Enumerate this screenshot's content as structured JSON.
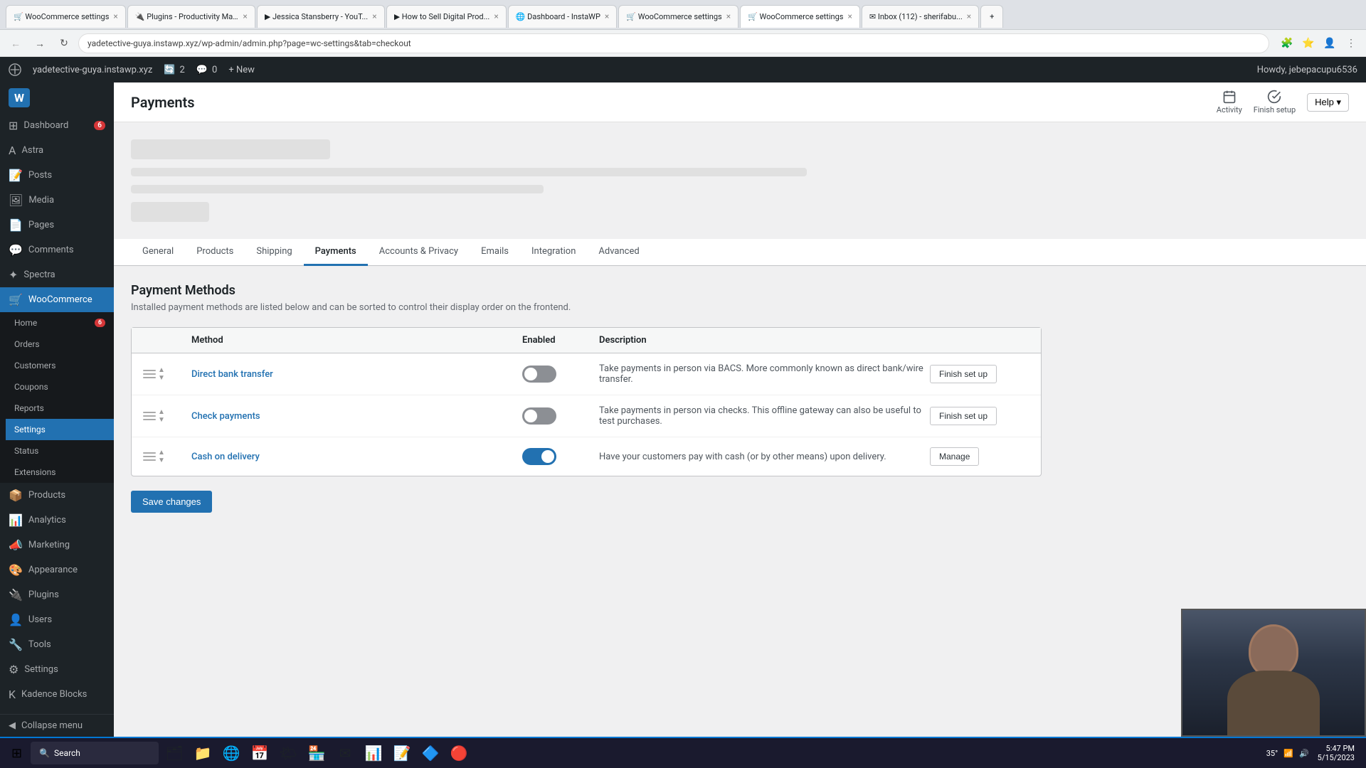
{
  "browser": {
    "tabs": [
      {
        "label": "WooCommerce settings",
        "active": false,
        "icon": "🛒"
      },
      {
        "label": "Plugins - Productivity Ma...",
        "active": false,
        "icon": "🔌"
      },
      {
        "label": "Jessica Stansberry - YouT...",
        "active": false,
        "icon": "▶"
      },
      {
        "label": "How to Sell Digital Prod...",
        "active": false,
        "icon": "▶"
      },
      {
        "label": "Dashboard - InstaWP",
        "active": false,
        "icon": "🌐"
      },
      {
        "label": "WooCommerce settings",
        "active": false,
        "icon": "🛒"
      },
      {
        "label": "WooCommerce settings",
        "active": true,
        "icon": "🛒"
      },
      {
        "label": "Inbox (112) - sherifabu...",
        "active": false,
        "icon": "✉"
      }
    ],
    "address": "yadetective-guya.instawp.xyz/wp-admin/admin.php?page=wc-settings&tab=checkout"
  },
  "admin_bar": {
    "site": "yadetective-guya.instawp.xyz",
    "updates_count": "2",
    "comments_count": "0",
    "new_label": "+ New",
    "howdy": "Howdy, jebepacupu6536"
  },
  "sidebar": {
    "logo_text": "W",
    "items": [
      {
        "label": "Dashboard",
        "icon": "⊞",
        "badge": "6"
      },
      {
        "label": "Astra",
        "icon": "A"
      },
      {
        "label": "Posts",
        "icon": "📝"
      },
      {
        "label": "Media",
        "icon": "🖼"
      },
      {
        "label": "Pages",
        "icon": "📄"
      },
      {
        "label": "Comments",
        "icon": "💬"
      },
      {
        "label": "Spectra",
        "icon": "✦"
      },
      {
        "label": "WooCommerce",
        "icon": "🛒",
        "active": true
      },
      {
        "label": "Home",
        "icon": "⌂",
        "badge": "6"
      },
      {
        "label": "Orders",
        "icon": ""
      },
      {
        "label": "Customers",
        "icon": ""
      },
      {
        "label": "Coupons",
        "icon": ""
      },
      {
        "label": "Reports",
        "icon": ""
      },
      {
        "label": "Settings",
        "icon": "",
        "active": true
      },
      {
        "label": "Status",
        "icon": ""
      },
      {
        "label": "Extensions",
        "icon": ""
      },
      {
        "label": "Products",
        "icon": "📦"
      },
      {
        "label": "Analytics",
        "icon": "📊"
      },
      {
        "label": "Marketing",
        "icon": "📣"
      },
      {
        "label": "Appearance",
        "icon": "🎨"
      },
      {
        "label": "Plugins",
        "icon": "🔌"
      },
      {
        "label": "Users",
        "icon": "👤"
      },
      {
        "label": "Tools",
        "icon": "🔧"
      },
      {
        "label": "Settings",
        "icon": "⚙"
      },
      {
        "label": "Kadence Blocks",
        "icon": "K"
      },
      {
        "label": "Collapse menu",
        "icon": "◀"
      }
    ],
    "search_label": "Search"
  },
  "header": {
    "title": "Payments",
    "activity_label": "Activity",
    "finish_setup_label": "Finish setup",
    "help_label": "Help ▾"
  },
  "tabs": [
    {
      "label": "General"
    },
    {
      "label": "Products"
    },
    {
      "label": "Shipping"
    },
    {
      "label": "Payments",
      "active": true
    },
    {
      "label": "Accounts & Privacy"
    },
    {
      "label": "Emails"
    },
    {
      "label": "Integration"
    },
    {
      "label": "Advanced"
    }
  ],
  "payment_methods": {
    "section_title": "Payment Methods",
    "section_desc": "Installed payment methods are listed below and can be sorted to control their display order on the frontend.",
    "columns": {
      "method": "Method",
      "enabled": "Enabled",
      "description": "Description"
    },
    "methods": [
      {
        "name": "Direct bank transfer",
        "enabled": false,
        "description": "Take payments in person via BACS. More commonly known as direct bank/wire transfer.",
        "action": "Finish set up"
      },
      {
        "name": "Check payments",
        "enabled": false,
        "description": "Take payments in person via checks. This offline gateway can also be useful to test purchases.",
        "action": "Finish set up"
      },
      {
        "name": "Cash on delivery",
        "enabled": true,
        "description": "Have your customers pay with cash (or by other means) upon delivery.",
        "action": "Manage"
      }
    ]
  },
  "save_button": "Save changes",
  "taskbar": {
    "search_placeholder": "Search",
    "time": "35°",
    "icons": [
      "🗂",
      "📁",
      "🌐",
      "📅",
      "📊",
      "🎯",
      "📋",
      "🔷"
    ]
  }
}
